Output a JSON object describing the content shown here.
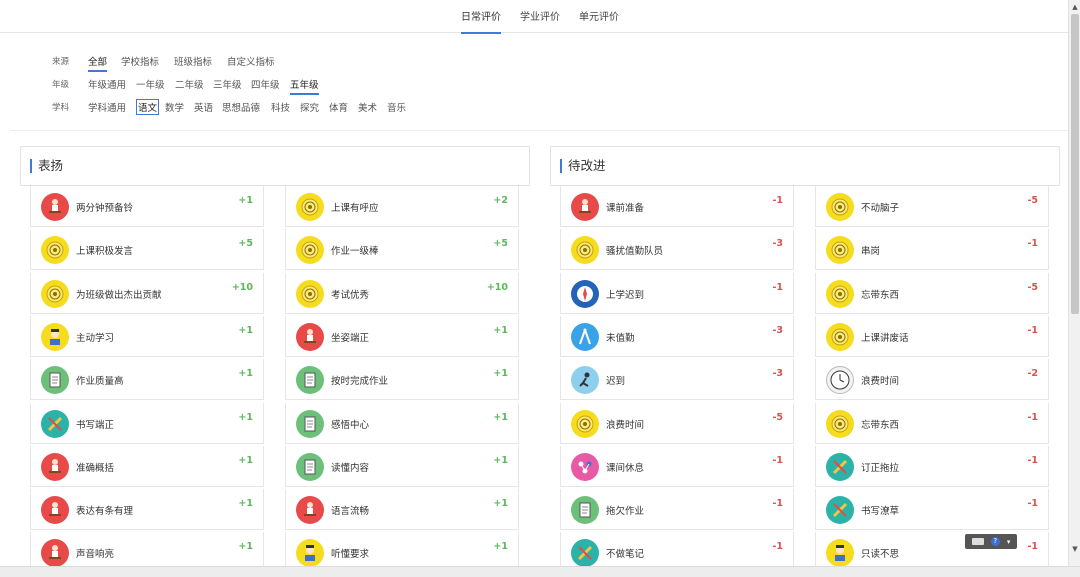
{
  "tabs": [
    {
      "label": "日常评价",
      "active": true
    },
    {
      "label": "学业评价",
      "active": false
    },
    {
      "label": "单元评价",
      "active": false
    }
  ],
  "filters": {
    "source": {
      "label": "来源",
      "options": [
        "全部",
        "学校指标",
        "班级指标",
        "自定义指标"
      ],
      "selected": 0
    },
    "grade": {
      "label": "年级",
      "options": [
        "年级通用",
        "一年级",
        "二年级",
        "三年级",
        "四年级",
        "五年级"
      ],
      "selected": 5
    },
    "subject": {
      "label": "学科",
      "options": [
        "学科通用",
        "语文",
        "数学",
        "英语",
        "思想品德",
        "科技",
        "探究",
        "体育",
        "美术",
        "音乐"
      ],
      "selected": 1
    }
  },
  "praise": {
    "title": "表扬",
    "columns": [
      [
        {
          "name": "两分钟预备铃",
          "score": "+1",
          "icon": "student-at-desk-icon",
          "color": "red"
        },
        {
          "name": "上课积极发言",
          "score": "+5",
          "icon": "medal-icon",
          "color": "yellow"
        },
        {
          "name": "为班级做出杰出贡献",
          "score": "+10",
          "icon": "medal-icon",
          "color": "yellow"
        },
        {
          "name": "主动学习",
          "score": "+1",
          "icon": "student-icon",
          "color": "yellow"
        },
        {
          "name": "作业质量高",
          "score": "+1",
          "icon": "notebook-icon",
          "color": "green"
        },
        {
          "name": "书写端正",
          "score": "+1",
          "icon": "pen-icon",
          "color": "teal"
        },
        {
          "name": "准确概括",
          "score": "+1",
          "icon": "student-at-desk-icon",
          "color": "red"
        },
        {
          "name": "表达有条有理",
          "score": "+1",
          "icon": "student-at-desk-icon",
          "color": "red"
        },
        {
          "name": "声音响亮",
          "score": "+1",
          "icon": "student-at-desk-icon",
          "color": "red"
        }
      ],
      [
        {
          "name": "上课有呼应",
          "score": "+2",
          "icon": "medal-icon",
          "color": "yellow"
        },
        {
          "name": "作业一级棒",
          "score": "+5",
          "icon": "medal-icon",
          "color": "yellow"
        },
        {
          "name": "考试优秀",
          "score": "+10",
          "icon": "medal-icon",
          "color": "yellow"
        },
        {
          "name": "坐姿端正",
          "score": "+1",
          "icon": "student-at-desk-icon",
          "color": "red"
        },
        {
          "name": "按时完成作业",
          "score": "+1",
          "icon": "notebook-icon",
          "color": "green"
        },
        {
          "name": "感悟中心",
          "score": "+1",
          "icon": "notebook-icon",
          "color": "green"
        },
        {
          "name": "读懂内容",
          "score": "+1",
          "icon": "notebook-icon",
          "color": "green"
        },
        {
          "name": "语言流畅",
          "score": "+1",
          "icon": "student-at-desk-icon",
          "color": "red"
        },
        {
          "name": "听懂要求",
          "score": "+1",
          "icon": "student-icon",
          "color": "yellow"
        }
      ]
    ]
  },
  "improve": {
    "title": "待改进",
    "columns": [
      [
        {
          "name": "课前准备",
          "score": "-1",
          "icon": "student-at-desk-icon",
          "color": "red"
        },
        {
          "name": "骚扰值勤队员",
          "score": "-3",
          "icon": "medal-icon",
          "color": "yellow"
        },
        {
          "name": "上学迟到",
          "score": "-1",
          "icon": "compass-icon",
          "color": "navy"
        },
        {
          "name": "未值勤",
          "score": "-3",
          "icon": "compass-drawing-icon",
          "color": "blue"
        },
        {
          "name": "迟到",
          "score": "-3",
          "icon": "running-icon",
          "color": "lightblue"
        },
        {
          "name": "浪费时间",
          "score": "-5",
          "icon": "medal-icon",
          "color": "yellow"
        },
        {
          "name": "课间休息",
          "score": "-1",
          "icon": "molecule-icon",
          "color": "pink"
        },
        {
          "name": "拖欠作业",
          "score": "-1",
          "icon": "notebook-icon",
          "color": "green"
        },
        {
          "name": "不做笔记",
          "score": "-1",
          "icon": "pen-icon",
          "color": "teal"
        }
      ],
      [
        {
          "name": "不动脑子",
          "score": "-5",
          "icon": "medal-icon",
          "color": "yellow"
        },
        {
          "name": "串岗",
          "score": "-1",
          "icon": "medal-icon",
          "color": "yellow"
        },
        {
          "name": "忘带东西",
          "score": "-5",
          "icon": "medal-icon",
          "color": "yellow"
        },
        {
          "name": "上课讲废话",
          "score": "-1",
          "icon": "medal-icon",
          "color": "yellow"
        },
        {
          "name": "浪费时间",
          "score": "-2",
          "icon": "clock-icon",
          "color": "white"
        },
        {
          "name": "忘带东西",
          "score": "-1",
          "icon": "medal-icon",
          "color": "yellow"
        },
        {
          "name": "订正拖拉",
          "score": "-1",
          "icon": "pen-icon",
          "color": "teal"
        },
        {
          "name": "书写潦草",
          "score": "-1",
          "icon": "pen-icon",
          "color": "teal"
        },
        {
          "name": "只读不思",
          "score": "-1",
          "icon": "student-icon",
          "color": "yellow"
        }
      ]
    ]
  },
  "colors": {
    "accent": "#3d7bd6",
    "positive": "#5cb85c",
    "negative": "#d9534f"
  }
}
